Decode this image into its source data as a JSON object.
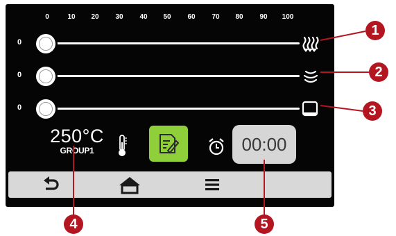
{
  "scale": {
    "ticks": [
      "0",
      "10",
      "20",
      "30",
      "40",
      "50",
      "60",
      "70",
      "80",
      "90",
      "100"
    ]
  },
  "sliders": [
    {
      "value_label": "0",
      "level": 0,
      "icon": "convection-heat-icon"
    },
    {
      "value_label": "0",
      "level": 0,
      "icon": "steam-humidity-icon"
    },
    {
      "value_label": "0",
      "level": 0,
      "icon": "bottom-heat-icon"
    }
  ],
  "temperature": {
    "value": "250°C",
    "group": "GROUP1"
  },
  "timer": {
    "value": "00:00"
  },
  "nav": {
    "items": [
      "back-icon",
      "home-icon",
      "menu-icon"
    ]
  },
  "callouts": [
    "1",
    "2",
    "3",
    "4",
    "5"
  ],
  "colors": {
    "screen_bg": "#050505",
    "recipe_button": "#8fcf3a",
    "timer_bg": "#d6d6d6",
    "nav_bg": "#d8d8d8",
    "callout": "#b31620"
  }
}
